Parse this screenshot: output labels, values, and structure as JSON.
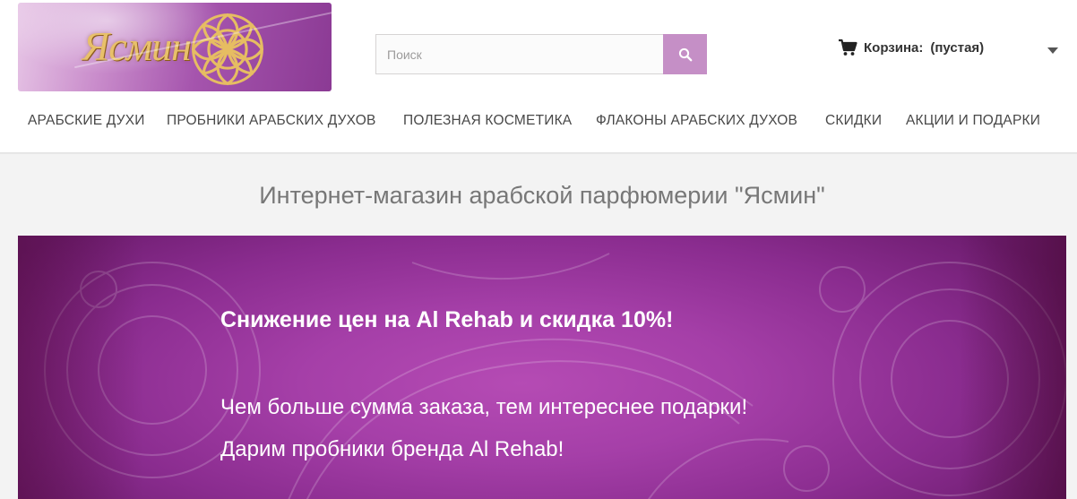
{
  "logo": {
    "text": "Ясмин"
  },
  "search": {
    "placeholder": "Поиск"
  },
  "cart": {
    "label": "Корзина:",
    "status": "(пустая)"
  },
  "menu": {
    "items": [
      "Арабские духи",
      "Пробники арабских духов",
      "Полезная косметика",
      "Флаконы арабских духов",
      "Скидки",
      "Акции и подарки"
    ]
  },
  "page": {
    "heading": "Интернет-магазин арабской парфюмерии \"Ясмин\""
  },
  "banner": {
    "title": "Снижение цен на Al Rehab и скидка 10%!",
    "line1": "Чем больше сумма заказа, тем интереснее подарки!",
    "line2": "Дарим пробники бренда Al Rehab!"
  },
  "colors": {
    "accent": "#c58fc6",
    "banner": "#a53fa8",
    "logo_text": "#e8c06a"
  }
}
